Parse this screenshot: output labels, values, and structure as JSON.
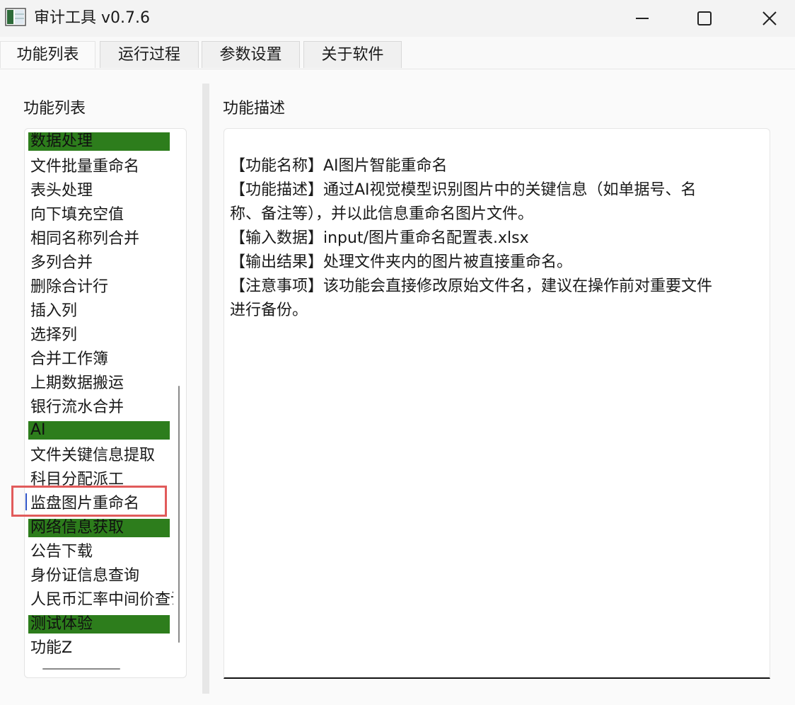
{
  "window": {
    "title": "审计工具 v0.7.6",
    "icons": {
      "app": "app-icon",
      "minimize": "minimize-icon",
      "maximize": "maximize-icon",
      "close": "close-icon"
    }
  },
  "tabs": [
    {
      "label": "功能列表",
      "active": true
    },
    {
      "label": "运行过程",
      "active": false
    },
    {
      "label": "参数设置",
      "active": false
    },
    {
      "label": "关于软件",
      "active": false
    }
  ],
  "left_panel": {
    "label": "功能列表",
    "items": [
      {
        "label": "数据处理",
        "category": true
      },
      {
        "label": "文件批量重命名"
      },
      {
        "label": "表头处理"
      },
      {
        "label": "向下填充空值"
      },
      {
        "label": "相同名称列合并"
      },
      {
        "label": "多列合并"
      },
      {
        "label": "删除合计行"
      },
      {
        "label": "插入列"
      },
      {
        "label": "选择列"
      },
      {
        "label": "合并工作簿"
      },
      {
        "label": "上期数据搬运"
      },
      {
        "label": "银行流水合并"
      },
      {
        "label": "AI",
        "category": true
      },
      {
        "label": "文件关键信息提取"
      },
      {
        "label": "科目分配派工"
      },
      {
        "label": "监盘图片重命名",
        "selected": true
      },
      {
        "label": "网络信息获取",
        "category": true
      },
      {
        "label": "公告下载"
      },
      {
        "label": "身份证信息查询"
      },
      {
        "label": "人民币汇率中间价查询"
      },
      {
        "label": "测试体验",
        "category": true
      },
      {
        "label": "功能Z"
      }
    ]
  },
  "right_panel": {
    "label": "功能描述",
    "lines": [
      "【功能名称】AI图片智能重命名",
      "【功能描述】通过AI视觉模型识别图片中的关键信息（如单据号、名",
      "称、备注等），并以此信息重命名图片文件。",
      "【输入数据】input/图片重命名配置表.xlsx",
      "【输出结果】处理文件夹内的图片被直接重命名。",
      "【注意事项】该功能会直接修改原始文件名，建议在操作前对重要文件",
      "进行备份。"
    ]
  },
  "colors": {
    "category_bg": "#2d7d1c",
    "selection_border": "#e15b5b"
  }
}
